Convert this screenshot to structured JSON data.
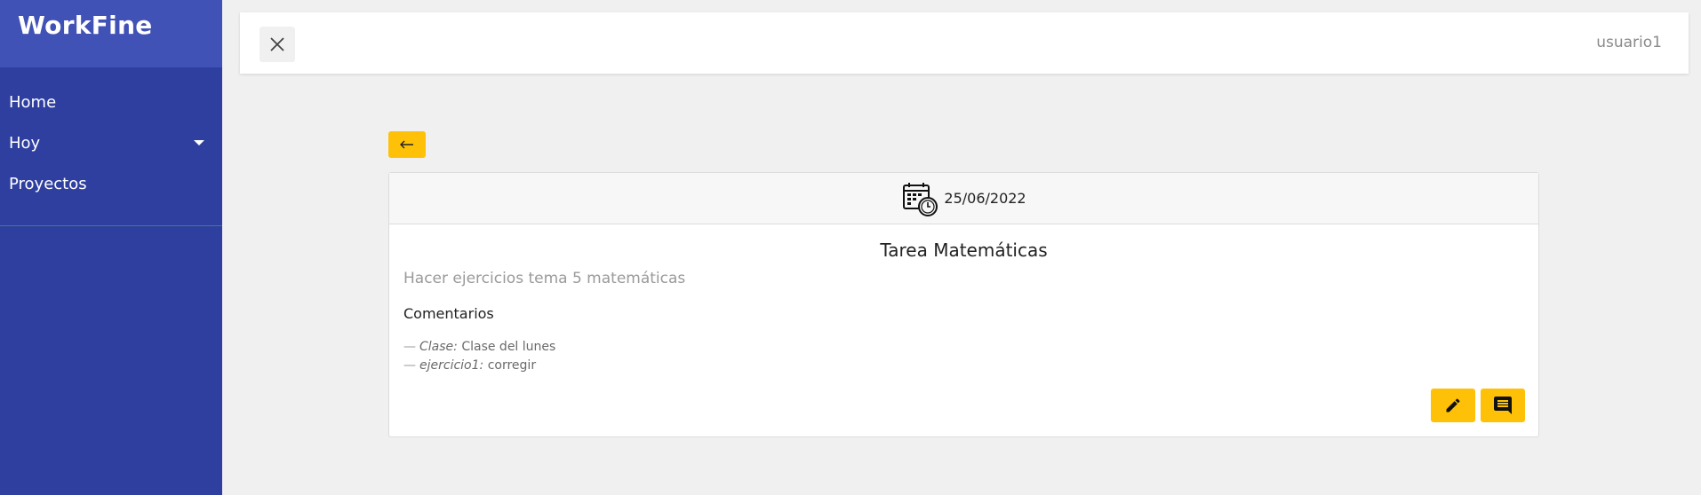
{
  "sidebar": {
    "brand": "WorkFine",
    "items": [
      {
        "label": "Home"
      },
      {
        "label": "Hoy"
      },
      {
        "label": "Proyectos"
      }
    ]
  },
  "topbar": {
    "username": "usuario1"
  },
  "task": {
    "date": "25/06/2022",
    "title": "Tarea Matemáticas",
    "description": "Hacer ejercicios tema 5 matemáticas",
    "comments_title": "Comentarios",
    "comments": [
      {
        "dash": "—",
        "author": "Clase:",
        "text": "Clase del lunes"
      },
      {
        "dash": "—",
        "author": "ejercicio1:",
        "text": "corregir"
      }
    ]
  },
  "colors": {
    "sidebar": "#2f3f9f",
    "brand_bar": "#4152b6",
    "accent": "#ffc107"
  },
  "icons": {
    "close": "close-icon",
    "back": "arrow-left-icon",
    "calendar": "calendar-clock-icon",
    "edit": "pencil-icon",
    "comment": "comment-icon",
    "dropdown": "chevron-down-icon"
  }
}
